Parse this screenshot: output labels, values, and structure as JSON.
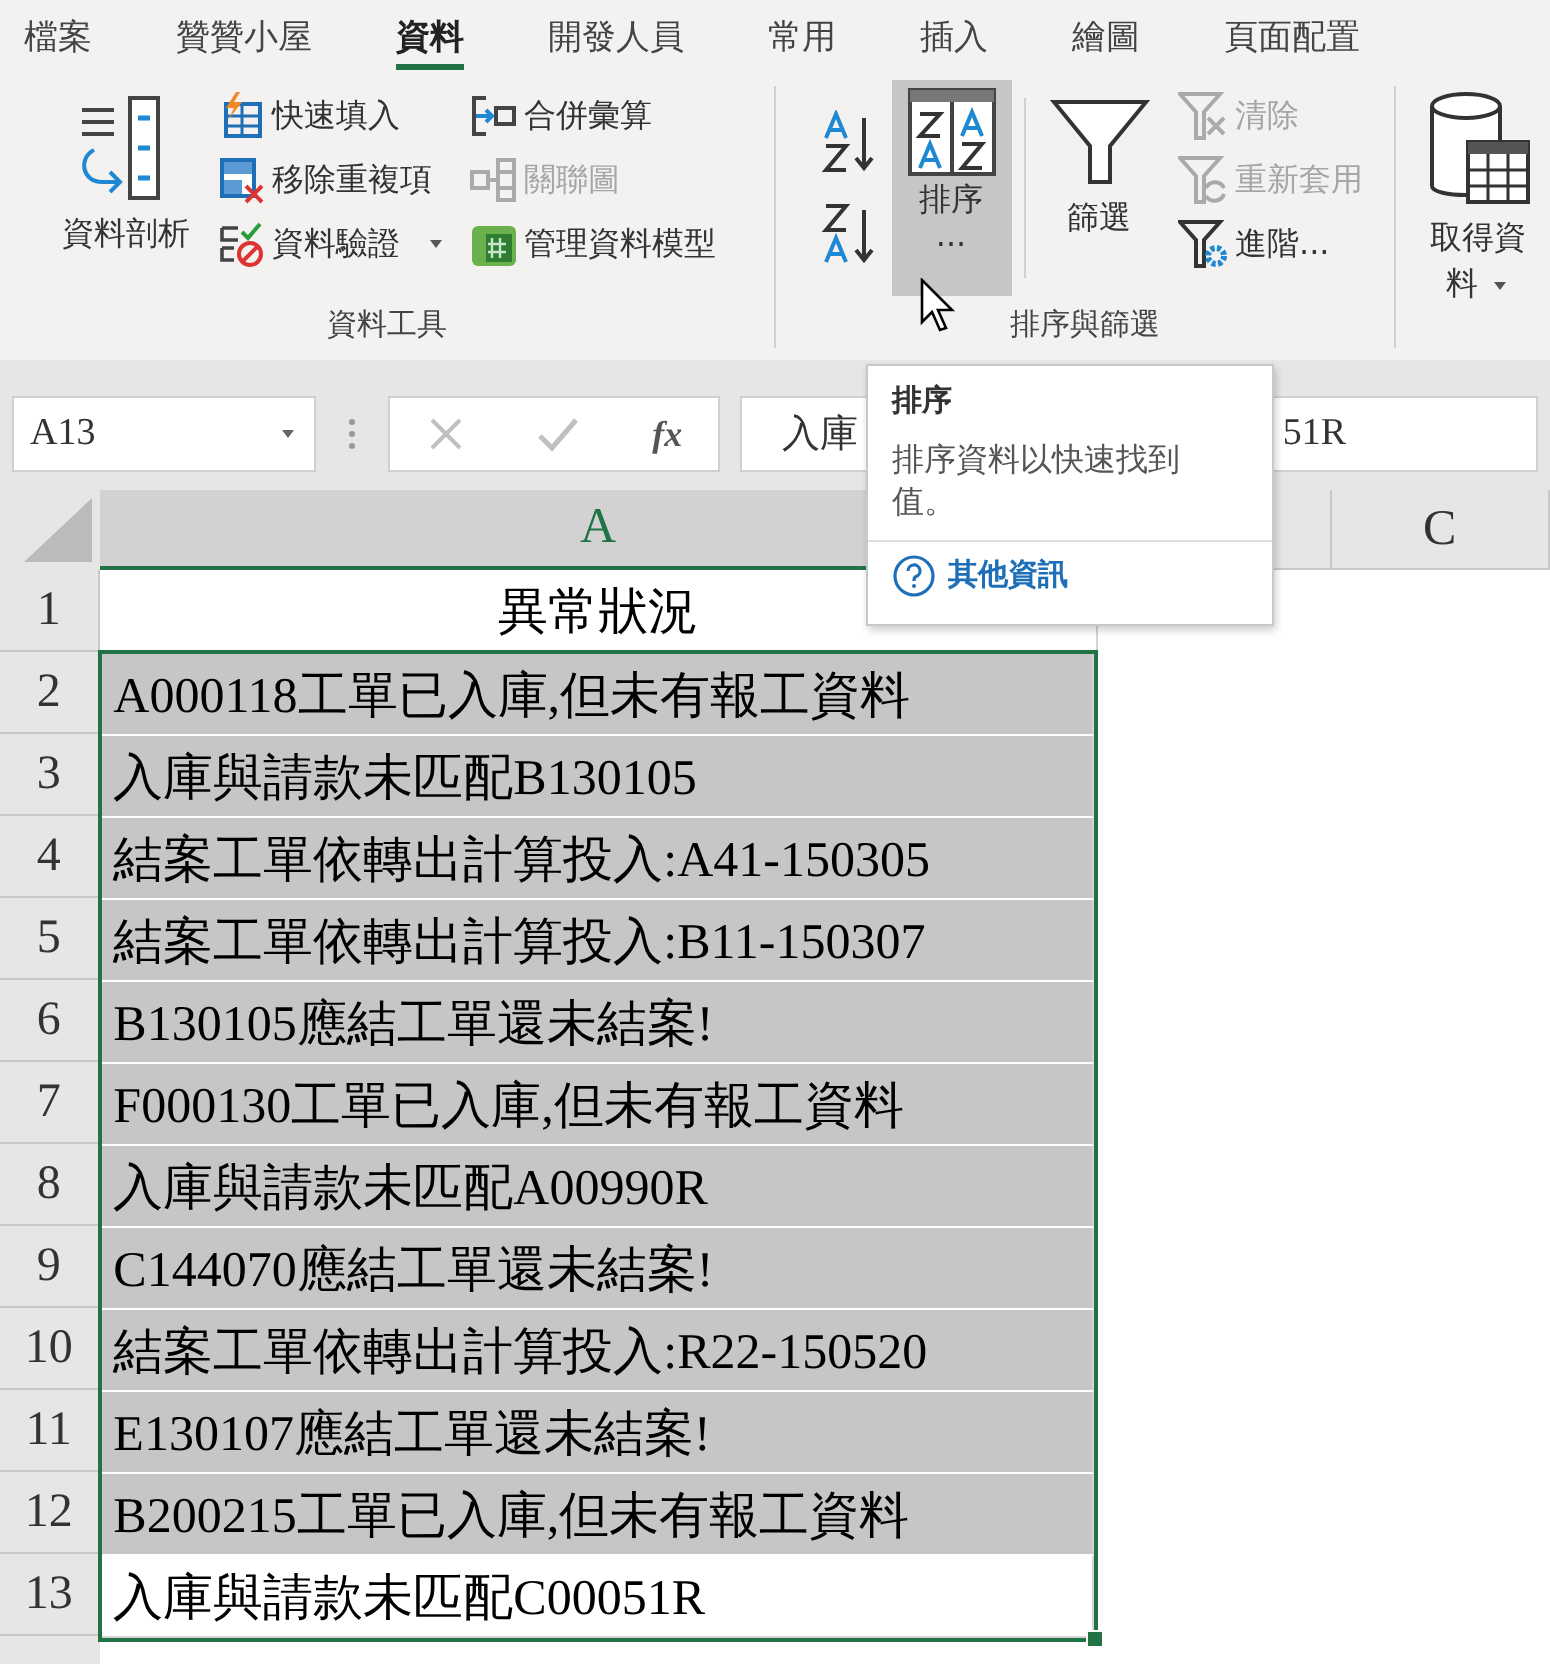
{
  "tabs": [
    {
      "label": "檔案",
      "selected": false
    },
    {
      "label": "贊贊小屋",
      "selected": false
    },
    {
      "label": "資料",
      "selected": true
    },
    {
      "label": "開發人員",
      "selected": false
    },
    {
      "label": "常用",
      "selected": false
    },
    {
      "label": "插入",
      "selected": false
    },
    {
      "label": "繪圖",
      "selected": false
    },
    {
      "label": "頁面配置",
      "selected": false
    }
  ],
  "data_tools": {
    "label": "資料工具",
    "large_button": "資料剖析",
    "col1": [
      {
        "label": "快速填入",
        "disabled": false,
        "dropdown": false
      },
      {
        "label": "移除重複項",
        "disabled": false,
        "dropdown": false
      },
      {
        "label": "資料驗證",
        "disabled": false,
        "dropdown": true
      }
    ],
    "col2": [
      {
        "label": "合併彙算",
        "disabled": false
      },
      {
        "label": "關聯圖",
        "disabled": true
      },
      {
        "label": "管理資料模型",
        "disabled": false
      }
    ]
  },
  "sort_filter": {
    "label": "排序與篩選",
    "sort_button": {
      "label": "排序",
      "sublabel": "...",
      "hovered": true
    },
    "filter_button": "篩選",
    "small": [
      {
        "label": "清除",
        "disabled": true
      },
      {
        "label": "重新套用",
        "disabled": true
      },
      {
        "label": "進階...",
        "disabled": false
      }
    ]
  },
  "get_data": {
    "label": "取得資料"
  },
  "formula_bar": {
    "name_box": "A13",
    "fx": "fx",
    "value_start": "入庫",
    "value_end": "51R"
  },
  "columns": [
    "A",
    "C"
  ],
  "title_row": {
    "number": "1",
    "text": "異常狀況"
  },
  "rows": [
    {
      "number": "2",
      "text": "A000118工單已入庫,但未有報工資料",
      "selected": true,
      "active": false
    },
    {
      "number": "3",
      "text": "入庫與請款未匹配B130105",
      "selected": true,
      "active": false
    },
    {
      "number": "4",
      "text": "結案工單依轉出計算投入:A41-150305",
      "selected": true,
      "active": false
    },
    {
      "number": "5",
      "text": "結案工單依轉出計算投入:B11-150307",
      "selected": true,
      "active": false
    },
    {
      "number": "6",
      "text": "B130105應結工單還未結案!",
      "selected": true,
      "active": false
    },
    {
      "number": "7",
      "text": "F000130工單已入庫,但未有報工資料",
      "selected": true,
      "active": false
    },
    {
      "number": "8",
      "text": "入庫與請款未匹配A00990R",
      "selected": true,
      "active": false
    },
    {
      "number": "9",
      "text": "C144070應結工單還未結案!",
      "selected": true,
      "active": false
    },
    {
      "number": "10",
      "text": "結案工單依轉出計算投入:R22-150520",
      "selected": true,
      "active": false
    },
    {
      "number": "11",
      "text": "E130107應結工單還未結案!",
      "selected": true,
      "active": false
    },
    {
      "number": "12",
      "text": "B200215工單已入庫,但未有報工資料",
      "selected": true,
      "active": false
    },
    {
      "number": "13",
      "text": "入庫與請款未匹配C00051R",
      "selected": true,
      "active": true
    }
  ],
  "tooltip": {
    "title": "排序",
    "description": "排序資料以快速找到值。",
    "link": "其他資訊"
  }
}
